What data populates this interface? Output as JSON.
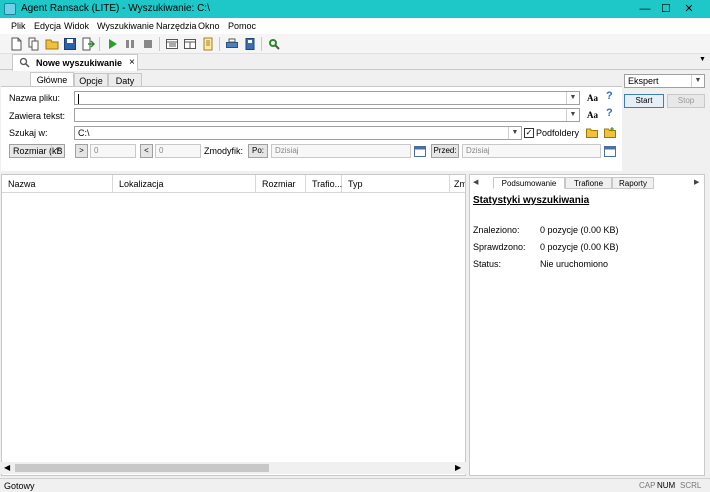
{
  "window": {
    "title": "Agent Ransack (LITE) - Wyszukiwanie: C:\\",
    "minimize": "—",
    "maximize": "☐",
    "close": "✕"
  },
  "menu": [
    "Plik",
    "Edycja",
    "Widok",
    "Wyszukiwanie",
    "Narzędzia",
    "Okno",
    "Pomoc"
  ],
  "doc_tab": {
    "label": "Nowe wyszukiwanie",
    "close": "×"
  },
  "search_tabs": [
    "Główne",
    "Opcje",
    "Daty"
  ],
  "form": {
    "filename_label": "Nazwa pliku:",
    "filename_value": "",
    "contains_label": "Zawiera tekst:",
    "contains_value": "",
    "lookin_label": "Szukaj w:",
    "lookin_value": "C:\\",
    "subfolders_label": "Podfoldery",
    "subfolders_checked": true,
    "aa_label": "Aa",
    "help_label": "?",
    "size_select": "Rozmiar (kB",
    "gt_label": ">",
    "gt_value": "0",
    "lt_label": "<",
    "lt_value": "0",
    "modified_label": "Zmodyfik:",
    "after_label": "Po:",
    "after_value": "Dzisiaj",
    "before_label": "Przed:",
    "before_value": "Dzisiaj"
  },
  "mode_select": "Ekspert",
  "start_label": "Start",
  "stop_label": "Stop",
  "columns": [
    "Nazwa",
    "Lokalizacja",
    "Rozmiar",
    "Trafio...",
    "Typ",
    "Zm"
  ],
  "right_tabs": [
    "Podsumowanie",
    "Trafione",
    "Raporty"
  ],
  "summary": {
    "heading": "Statystyki wyszukiwania",
    "found_label": "Znaleziono:",
    "found_value": "0 pozycje (0.00 KB)",
    "checked_label": "Sprawdzono:",
    "checked_value": "0 pozycje (0.00 KB)",
    "status_label": "Status:",
    "status_value": "Nie uruchomiono"
  },
  "status": {
    "text": "Gotowy",
    "cap": "CAP",
    "num": "NUM",
    "scrl": "SCRL"
  }
}
